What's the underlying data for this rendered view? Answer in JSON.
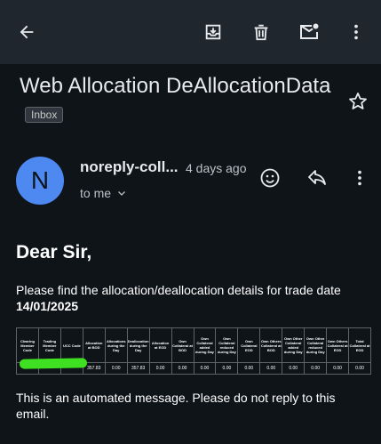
{
  "toolbar": {
    "back_icon": "arrow-back-icon",
    "archive_icon": "archive-icon",
    "delete_icon": "trash-icon",
    "mark_unread_icon": "mark-unread-icon",
    "more_icon": "more-vert-icon"
  },
  "email": {
    "subject": "Web Allocation DeAllocationData",
    "label": "Inbox",
    "sender_initial": "N",
    "sender_name": "noreply-coll...",
    "time_ago": "4 days ago",
    "to_text": "to me",
    "greeting": "Dear Sir,",
    "intro": "Please find the allocation/deallocation details for trade date ",
    "trade_date": "14/01/2025",
    "footer": "This is an automated message. Please do not reply to this email."
  },
  "table": {
    "headers": [
      "Clearing Member Code",
      "Trading Member Code",
      "UCC Code",
      "Allocation at BOD",
      "Allocations during the Day",
      "Deallocation during the Day",
      "Allocation at EOD",
      "Own Collateral at BOD",
      "Own Collateral added during Day",
      "Own Collateral reduced during Day",
      "Own Collateral EOD",
      "Own Others Collateral at BOD",
      "Own Other Collateral added during Day",
      "Own Other Collateral reduced during Day",
      "Own Others Collateral at EOD",
      "Total Collateral at EOD"
    ],
    "row": [
      "",
      "",
      "",
      "357.83",
      "0.00",
      "357.83",
      "0.00",
      "0.00",
      "0.00",
      "0.00",
      "0.00",
      "0.00",
      "0.00",
      "0.00",
      "0.00",
      "0.00"
    ]
  },
  "colors": {
    "background": "#0f1419",
    "topbar": "#1f262d",
    "avatar": "#4e88f1",
    "redaction": "#3fe022"
  }
}
